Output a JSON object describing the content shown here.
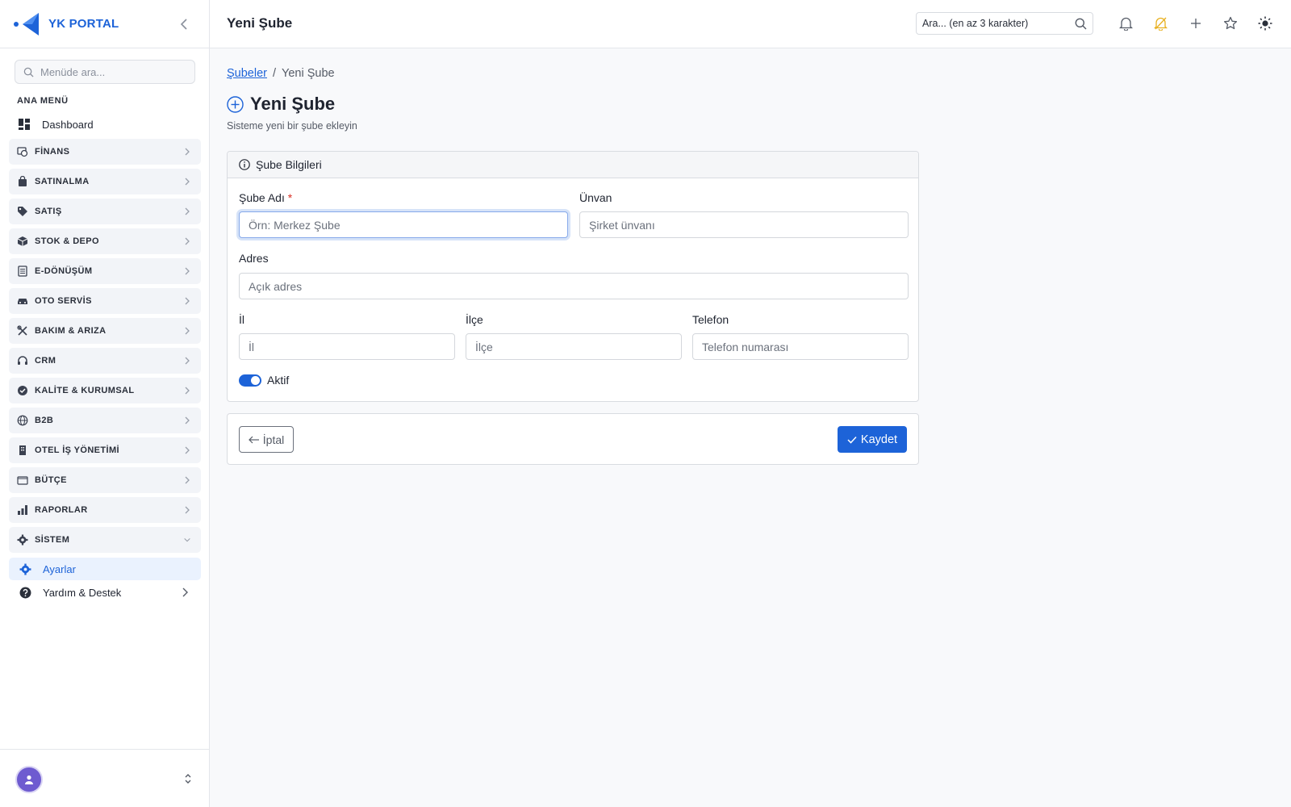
{
  "brand": {
    "name": "YK PORTAL",
    "accent": "#1d63d8"
  },
  "sidebar": {
    "search_placeholder": "Menüde ara...",
    "section_title": "ANA MENÜ",
    "dashboard": {
      "label": "Dashboard",
      "icon": "dashboard-icon"
    },
    "groups": [
      {
        "label": "FİNANS",
        "icon": "finance-icon",
        "expanded": false
      },
      {
        "label": "SATINALMA",
        "icon": "shopping-bag-icon",
        "expanded": false
      },
      {
        "label": "SATIŞ",
        "icon": "tag-icon",
        "expanded": false
      },
      {
        "label": "STOK & DEPO",
        "icon": "box-icon",
        "expanded": false
      },
      {
        "label": "E-DÖNÜŞÜM",
        "icon": "document-icon",
        "expanded": false
      },
      {
        "label": "OTO SERVİS",
        "icon": "car-icon",
        "expanded": false
      },
      {
        "label": "BAKIM & ARIZA",
        "icon": "tools-icon",
        "expanded": false
      },
      {
        "label": "CRM",
        "icon": "headset-icon",
        "expanded": false
      },
      {
        "label": "KALİTE & KURUMSAL",
        "icon": "badge-check-icon",
        "expanded": false
      },
      {
        "label": "B2B",
        "icon": "globe-icon",
        "expanded": false
      },
      {
        "label": "OTEL İŞ YÖNETİMİ",
        "icon": "building-icon",
        "expanded": false
      },
      {
        "label": "BÜTÇE",
        "icon": "wallet-icon",
        "expanded": false
      },
      {
        "label": "RAPORLAR",
        "icon": "bar-chart-icon",
        "expanded": false
      },
      {
        "label": "SİSTEM",
        "icon": "gear-icon",
        "expanded": true
      }
    ],
    "active_item": {
      "label": "Ayarlar",
      "icon": "gear-icon"
    },
    "help": {
      "label": "Yardım & Destek",
      "icon": "question-icon"
    }
  },
  "topbar": {
    "title": "Yeni Şube",
    "search_placeholder": "Ara... (en az 3 karakter)"
  },
  "breadcrumb": {
    "parent": "Şubeler",
    "separator": "/",
    "current": "Yeni Şube"
  },
  "page": {
    "title": "Yeni Şube",
    "subtitle": "Sisteme yeni bir şube ekleyin"
  },
  "form": {
    "card_title": "Şube Bilgileri",
    "fields": {
      "name": {
        "label": "Şube Adı",
        "required_mark": "*",
        "placeholder": "Örn: Merkez Şube",
        "value": ""
      },
      "title": {
        "label": "Ünvan",
        "placeholder": "Şirket ünvanı",
        "value": ""
      },
      "address": {
        "label": "Adres",
        "placeholder": "Açık adres",
        "value": ""
      },
      "city": {
        "label": "İl",
        "placeholder": "İl",
        "value": ""
      },
      "district": {
        "label": "İlçe",
        "placeholder": "İlçe",
        "value": ""
      },
      "phone": {
        "label": "Telefon",
        "placeholder": "Telefon numarası",
        "value": ""
      }
    },
    "active_toggle": {
      "label": "Aktif",
      "on": true
    }
  },
  "actions": {
    "cancel_label": "İptal",
    "save_label": "Kaydet"
  }
}
